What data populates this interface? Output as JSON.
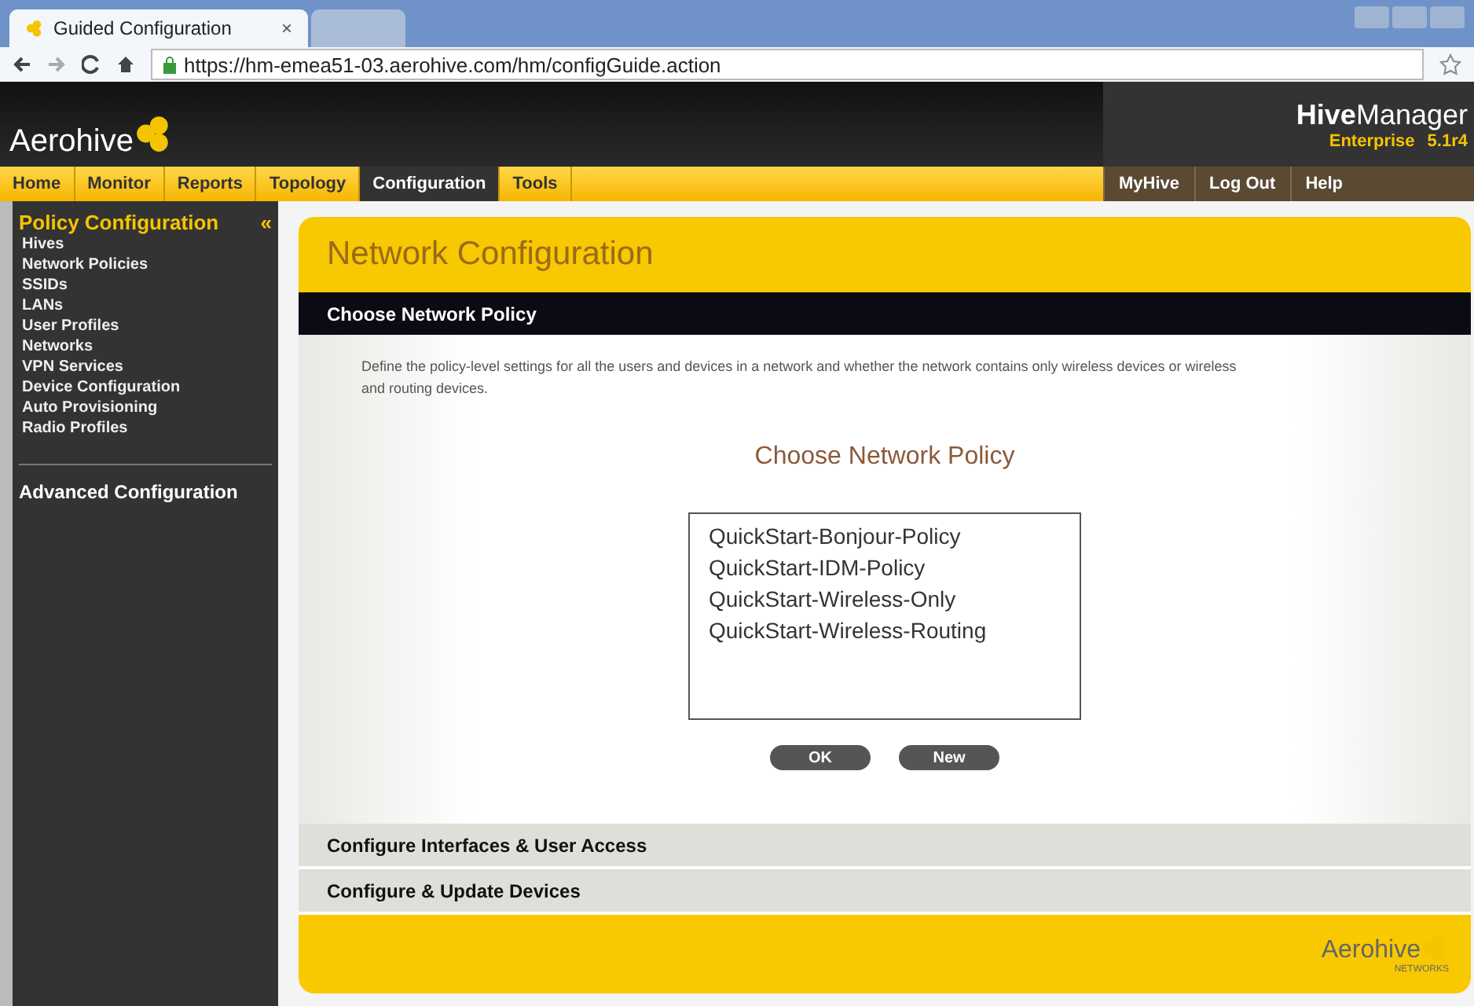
{
  "browser": {
    "tabs": [
      {
        "title": "Guided Configuration",
        "close": "×",
        "selected": true
      },
      {
        "selected": false
      }
    ],
    "url": "https://hm-emea51-03.aerohive.com/hm/configGuide.action"
  },
  "header": {
    "logo": "Aerohive",
    "product": "**Hive**Manager",
    "edition": "Enterprise",
    "version": "5.1r4"
  },
  "nav": {
    "left": [
      {
        "label": "Home",
        "selected": false
      },
      {
        "label": "Monitor",
        "selected": false
      },
      {
        "label": "Reports",
        "selected": false
      },
      {
        "label": "Topology",
        "selected": false
      },
      {
        "label": "Configuration",
        "selected": true
      },
      {
        "label": "Tools",
        "selected": false
      }
    ],
    "right": [
      {
        "label": "MyHive"
      },
      {
        "label": "Log Out"
      },
      {
        "label": "Help"
      }
    ]
  },
  "sidebar": {
    "title": "Policy Configuration",
    "collapse": "«",
    "items": [
      {
        "label": "Hives"
      },
      {
        "label": "Network Policies"
      },
      {
        "label": "SSIDs"
      },
      {
        "label": "LANs"
      },
      {
        "label": "User Profiles"
      },
      {
        "label": "Networks"
      },
      {
        "label": "VPN Services"
      },
      {
        "label": "Device Configuration"
      },
      {
        "label": "Auto Provisioning"
      },
      {
        "label": "Radio Profiles"
      }
    ],
    "section": "Advanced Configuration"
  },
  "main": {
    "title": "Network Configuration",
    "steps": [
      {
        "title": "Choose Network Policy",
        "expanded": true
      },
      {
        "title": "Configure Interfaces & User Access",
        "expanded": false
      },
      {
        "title": "Configure & Update Devices",
        "expanded": false
      }
    ],
    "description": "Define the policy-level settings for all the users and devices in a network and whether the network contains only wireless devices or wireless and routing devices.",
    "heading": "Choose Network Policy",
    "policies": [
      {
        "label": "QuickStart-Bonjour-Policy",
        "selected": false
      },
      {
        "label": "QuickStart-IDM-Policy",
        "selected": false
      },
      {
        "label": "QuickStart-Wireless-Only",
        "selected": false
      },
      {
        "label": "QuickStart-Wireless-Routing",
        "selected": false
      }
    ],
    "buttons": [
      "OK",
      "New"
    ],
    "footer_logo": "Aerohive",
    "footer_tagline": "NETWORKS"
  }
}
